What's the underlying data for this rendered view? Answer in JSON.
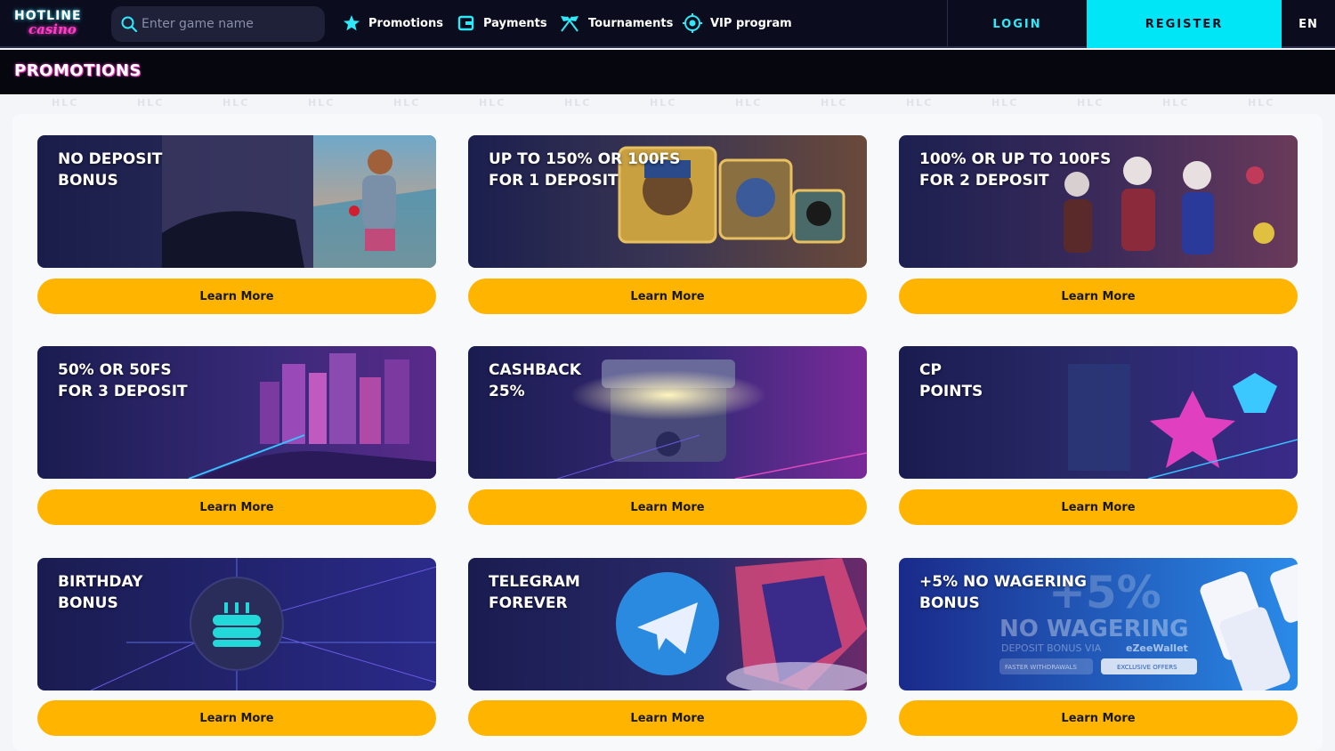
{
  "header": {
    "logo_top": "HOTLINE",
    "logo_bottom": "casino",
    "search_placeholder": "Enter game name",
    "nav": [
      {
        "label": "Promotions",
        "icon": "star-icon"
      },
      {
        "label": "Payments",
        "icon": "wallet-icon"
      },
      {
        "label": "Tournaments",
        "icon": "crossed-flags-icon"
      },
      {
        "label": "VIP program",
        "icon": "vip-target-icon"
      }
    ],
    "login_label": "LOGIN",
    "register_label": "REGISTER",
    "language": "EN"
  },
  "page_title": "PROMOTIONS",
  "watermark": "HLC",
  "promotions": [
    {
      "line1": "NO DEPOSIT",
      "line2": "BONUS",
      "button": "Learn More"
    },
    {
      "line1": "UP TO 150% OR 100FS",
      "line2": "FOR 1 DEPOSIT",
      "button": "Learn More"
    },
    {
      "line1": "100% OR UP TO 100FS",
      "line2": "FOR 2 DEPOSIT",
      "button": "Learn More"
    },
    {
      "line1": "50% OR 50FS",
      "line2": "FOR 3 DEPOSIT",
      "button": "Learn More"
    },
    {
      "line1": "CASHBACK",
      "line2": "25%",
      "button": "Learn More"
    },
    {
      "line1": "CP",
      "line2": "POINTS",
      "button": "Learn More"
    },
    {
      "line1": "BIRTHDAY",
      "line2": "BONUS",
      "button": "Learn More"
    },
    {
      "line1": "TELEGRAM",
      "line2": "FOREVER",
      "button": "Learn More"
    },
    {
      "line1": "+5% NO WAGERING",
      "line2": "BONUS",
      "button": "Learn More"
    }
  ],
  "ezee_banner": {
    "big": "+5%",
    "headline": "NO WAGERING",
    "sub": "DEPOSIT BONUS VIA",
    "brand": "eZeeWallet",
    "chip1": "FASTER WITHDRAWALS",
    "chip2": "EXCLUSIVE OFFERS"
  },
  "colors": {
    "header_bg": "#0b0d1f",
    "accent_cyan": "#00e6f6",
    "button_yellow": "#ffb400",
    "title_glow": "#ff3ec8"
  }
}
